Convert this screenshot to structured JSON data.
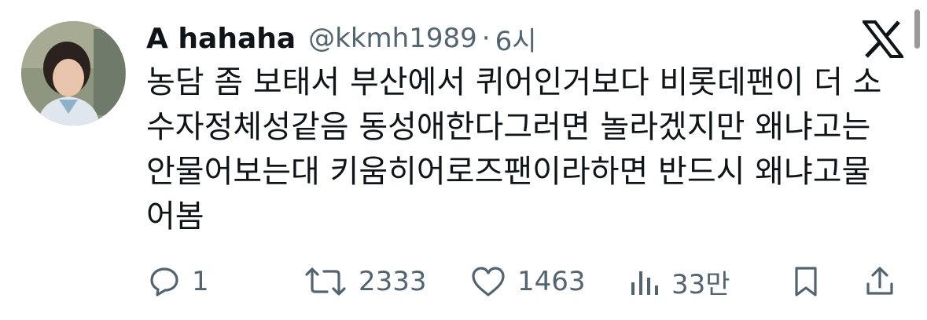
{
  "user": {
    "display_name": "A hahaha",
    "handle": "@kkmh1989",
    "separator": "·",
    "time": "6시"
  },
  "tweet": {
    "lines": [
      "농담 좀 보태서 부산에서 퀴어인거보다 비롯데팬이 더 소",
      "수자정체성같음 동성애한다그러면 놀라겠지만 왜냐고는",
      "안물어보는대 키움히어로즈팬이라하면 반드시 왜냐고물",
      "어봄"
    ]
  },
  "actions": {
    "reply_count": "1",
    "retweet_count": "2333",
    "like_count": "1463",
    "view_count": "33만"
  },
  "icons": {
    "logo": "x-logo-icon",
    "reply": "reply-icon",
    "retweet": "retweet-icon",
    "like": "heart-icon",
    "views": "views-icon",
    "bookmark": "bookmark-icon",
    "share": "share-icon"
  },
  "colors": {
    "text_primary": "#0f1419",
    "text_secondary": "#536471",
    "background": "#ffffff"
  }
}
